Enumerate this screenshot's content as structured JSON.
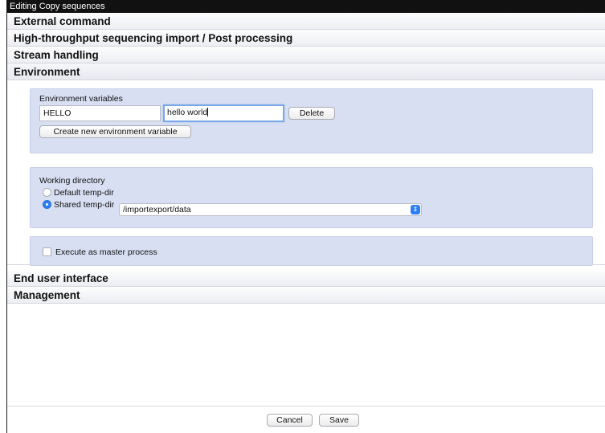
{
  "window": {
    "title": "Editing Copy sequences"
  },
  "sections": {
    "external_command": "External command",
    "hts_import": "High-throughput sequencing import / Post processing",
    "stream_handling": "Stream handling",
    "environment": "Environment",
    "end_user_interface": "End user interface",
    "management": "Management"
  },
  "environment": {
    "env_vars": {
      "label": "Environment variables",
      "name_value": "HELLO",
      "value_value": "hello world",
      "delete_label": "Delete",
      "create_label": "Create new environment variable"
    },
    "working_directory": {
      "label": "Working directory",
      "default_option": "Default temp-dir",
      "shared_option": "Shared temp-dir",
      "selected": "shared",
      "shared_path": "/importexport/data"
    },
    "master_process": {
      "label": "Execute as master process",
      "checked": false
    }
  },
  "footer": {
    "cancel_label": "Cancel",
    "save_label": "Save"
  },
  "icons": {
    "select_arrow": "up-down-arrows-icon"
  }
}
